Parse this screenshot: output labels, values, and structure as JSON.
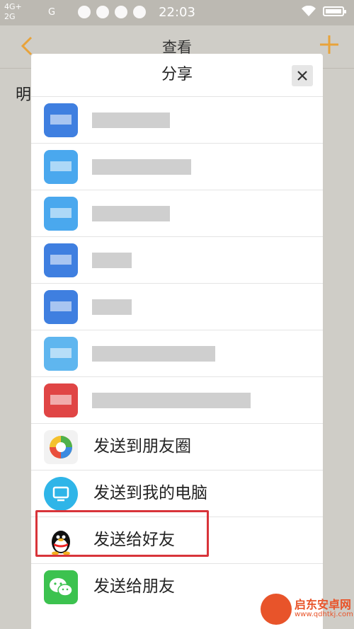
{
  "status_bar": {
    "network_1": "4G+",
    "network_2": "2G",
    "network_3": "G",
    "time": "22:03"
  },
  "header": {
    "title": "查看",
    "back_icon": "chevron-left-icon",
    "add_icon": "plus-icon"
  },
  "background": {
    "text": "明"
  },
  "dialog": {
    "title": "分享",
    "close_icon": "close-icon",
    "items": [
      {
        "label": "",
        "icon_color": "#3f7fe0",
        "blurred": true,
        "bar_width": 110
      },
      {
        "label": "",
        "icon_color": "#4aa8ee",
        "blurred": true,
        "bar_width": 140
      },
      {
        "label": "",
        "icon_color": "#4aa8ee",
        "blurred": true,
        "bar_width": 110
      },
      {
        "label": "",
        "icon_color": "#3f7fe0",
        "blurred": true,
        "bar_width": 56
      },
      {
        "label": "",
        "icon_color": "#3f7fe0",
        "blurred": true,
        "bar_width": 56
      },
      {
        "label": "",
        "icon_color": "#5fb6ef",
        "blurred": true,
        "bar_width": 174
      },
      {
        "label": "",
        "icon_color": "#e04545",
        "blurred": true,
        "bar_width": 224
      },
      {
        "label": "发送到朋友圈",
        "icon_color": "#f2f2f2",
        "icon": "moments-icon",
        "blurred": false
      },
      {
        "label": "发送到我的电脑",
        "icon_color": "#2fb5e8",
        "icon": "computer-icon",
        "blurred": false
      },
      {
        "label": "发送给好友",
        "icon_color": "#ffffff",
        "icon": "qq-penguin-icon",
        "blurred": false
      },
      {
        "label": "发送给朋友",
        "icon_color": "#3cc24f",
        "icon": "wechat-icon",
        "blurred": false
      }
    ]
  },
  "watermark": {
    "name": "启东安卓网",
    "url": "www.qdhtkj.com"
  },
  "colors": {
    "accent_orange": "#e8a33a",
    "highlight_red": "#d8343a"
  }
}
